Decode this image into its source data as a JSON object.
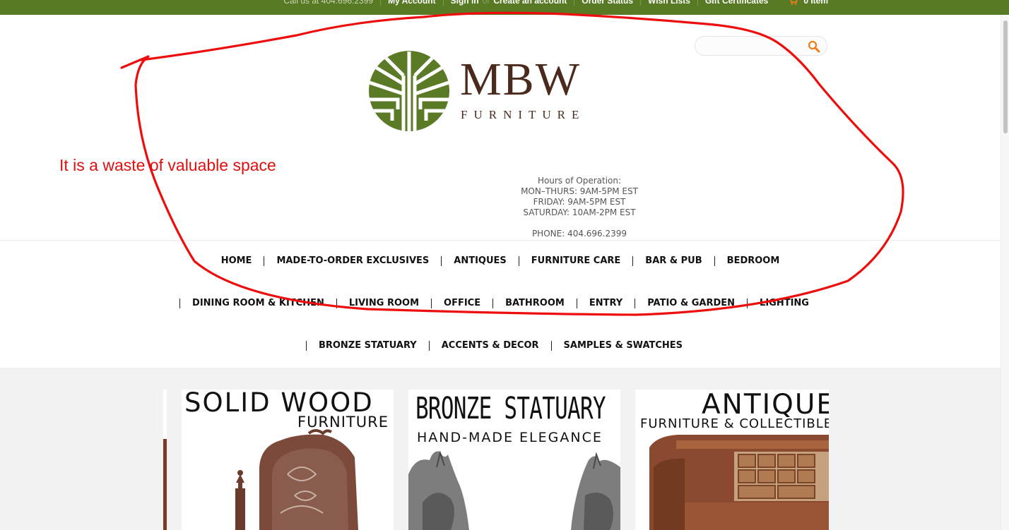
{
  "topbar": {
    "call": "Call us at 404.696.2399",
    "links": [
      "My Account",
      "Sign in",
      "Create an account",
      "Order Status",
      "Wish Lists",
      "Gift Certificates"
    ],
    "or": "or",
    "cart": "0 Item"
  },
  "colors": {
    "topbar_bg": "#587a24",
    "brand_green": "#5b7a25",
    "brand_brown": "#4b2a1e",
    "annotation_red": "#e20f0f",
    "search_accent": "#f07d1a"
  },
  "search": {
    "placeholder": "",
    "icon": "search-icon"
  },
  "logo": {
    "main": "MBW",
    "sub": "FURNITURE"
  },
  "annotation": {
    "note": "It is a waste of valuable space"
  },
  "hours": {
    "title": "Hours of Operation:",
    "lines": [
      "MON–THURS: 9AM-5PM EST",
      "FRIDAY: 9AM-5PM EST",
      "SATURDAY: 10AM-2PM EST"
    ],
    "phone": "PHONE: 404.696.2399"
  },
  "nav": {
    "row1": [
      "HOME",
      "MADE-TO-ORDER EXCLUSIVES",
      "ANTIQUES",
      "FURNITURE CARE",
      "BAR & PUB",
      "BEDROOM"
    ],
    "row2": [
      "DINING ROOM & KITCHEN",
      "LIVING ROOM",
      "OFFICE",
      "BATHROOM",
      "ENTRY",
      "PATIO & GARDEN",
      "LIGHTING"
    ],
    "row3": [
      "BRONZE STATUARY",
      "ACCENTS & DECOR",
      "SAMPLES & SWATCHES"
    ]
  },
  "banners": [
    {
      "title": "SOLID WOOD",
      "subtitle": "FURNITURE"
    },
    {
      "title": "BRONZE STATUARY",
      "subtitle": "HAND-MADE ELEGANCE"
    },
    {
      "title": "ANTIQUE",
      "subtitle": "FURNITURE & COLLECTIBLES"
    }
  ]
}
